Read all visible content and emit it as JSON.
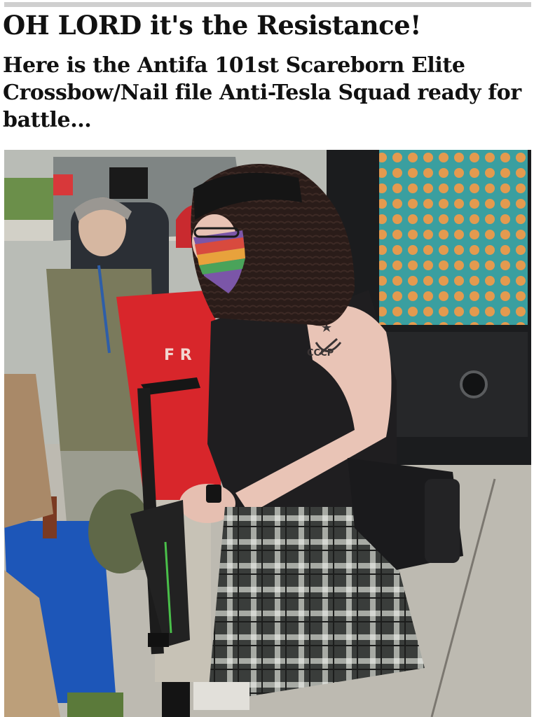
{
  "caption": {
    "headline": "OH LORD it's the Resistance!",
    "subhead": "Here is the Antifa 101st Scareborn Elite Crossbow/Nail file Anti-Tesla Squad ready for battle..."
  },
  "photo": {
    "tattoo_text": "CCCP",
    "shirt_text": "F R"
  },
  "colors": {
    "caption_text": "#111111",
    "background": "#ffffff",
    "shirt_red": "#d8262b",
    "barrel_blue": "#1d56b8",
    "screen_teal": "#3a9fa0"
  }
}
